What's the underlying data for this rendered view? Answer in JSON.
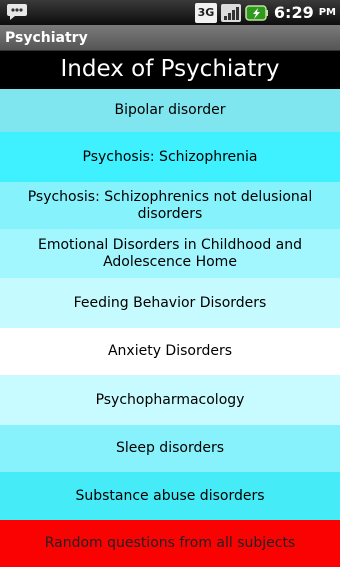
{
  "status_bar": {
    "time": "6:29",
    "ampm": "PM",
    "network_type": "3G",
    "icons": [
      "notification-icon",
      "network-3g-icon",
      "signal-icon",
      "battery-charging-icon"
    ]
  },
  "app": {
    "title": "Psychiatry"
  },
  "header": {
    "title": "Index of Psychiatry"
  },
  "menu": {
    "items": [
      {
        "label": "Bipolar disorder",
        "color": "#7fe6ef"
      },
      {
        "label": "Psychosis: Schizophrenia",
        "color": "#3ff0ff"
      },
      {
        "label": "Psychosis: Schizophrenics not delusional disorders",
        "color": "#86f2fc"
      },
      {
        "label": "Emotional Disorders in Childhood and Adolescence Home",
        "color": "#a2f6fd"
      },
      {
        "label": "Feeding Behavior Disorders",
        "color": "#c5fafe"
      },
      {
        "label": "Anxiety Disorders",
        "color": "#ffffff"
      },
      {
        "label": "Psychopharmacology",
        "color": "#c7fbff"
      },
      {
        "label": "Sleep disorders",
        "color": "#88f2fc"
      },
      {
        "label": "Substance abuse disorders",
        "color": "#45ecf7"
      },
      {
        "label": "Random questions from all subjects",
        "color": "#fa0202"
      }
    ]
  }
}
